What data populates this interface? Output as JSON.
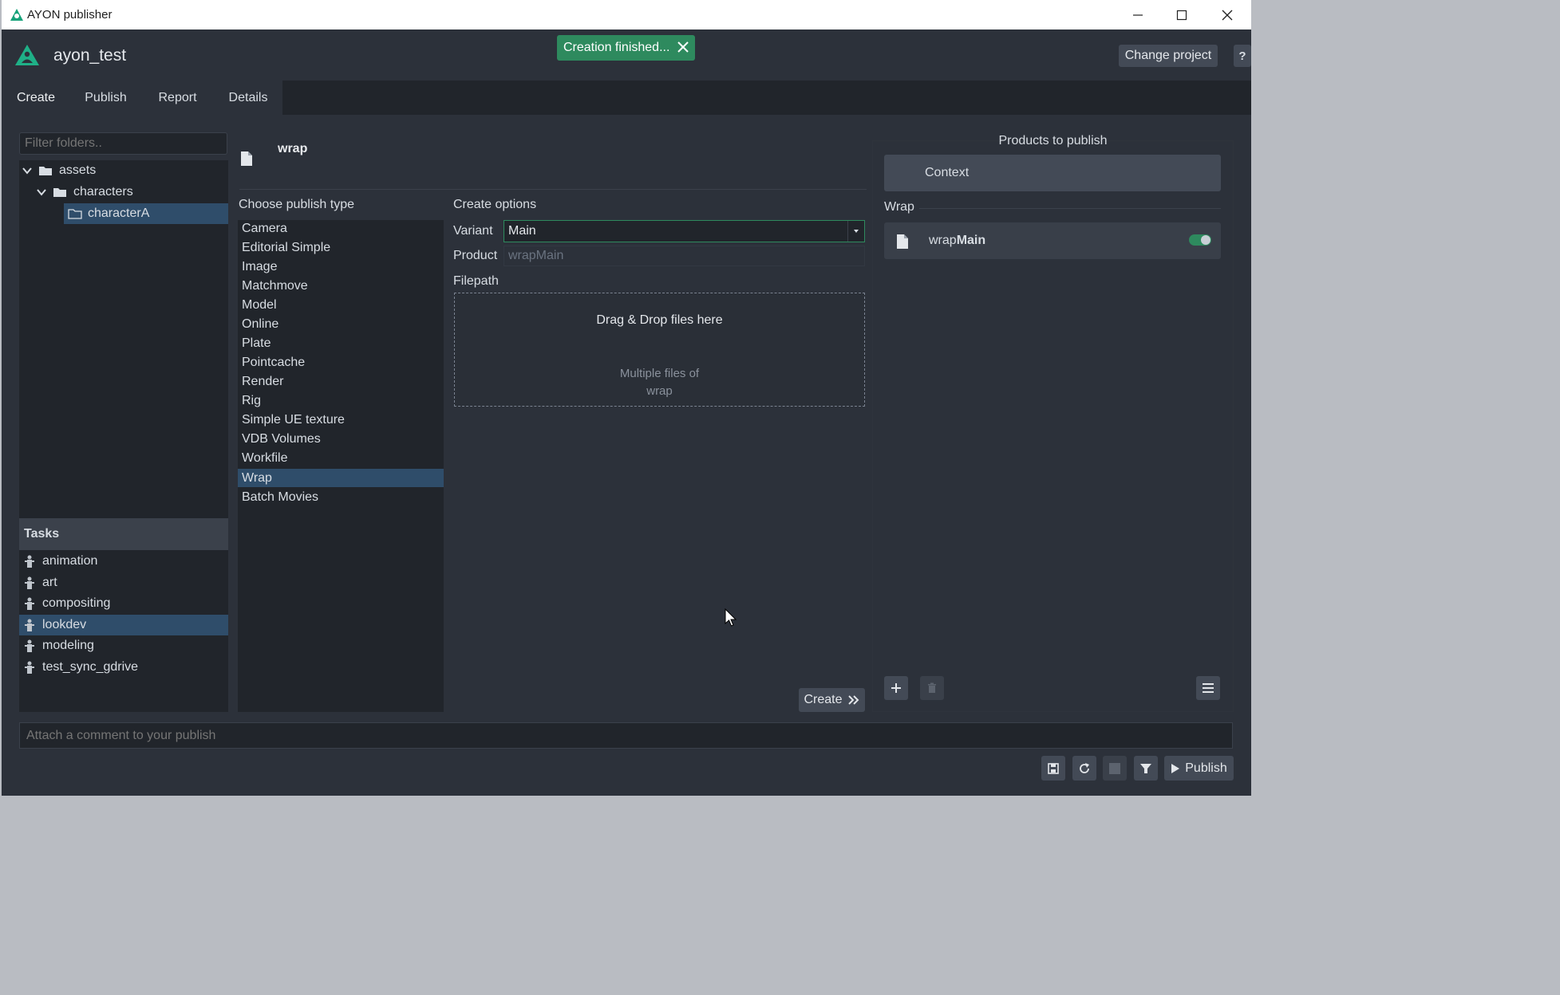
{
  "window": {
    "title": "AYON publisher"
  },
  "header": {
    "project": "ayon_test",
    "toast": "Creation finished...",
    "change_project": "Change project",
    "help": "?"
  },
  "tabs": [
    "Create",
    "Publish",
    "Report",
    "Details"
  ],
  "folders": {
    "filter_placeholder": "Filter folders..",
    "items": [
      "assets",
      "characters",
      "characterA"
    ]
  },
  "tasks": {
    "header": "Tasks",
    "items": [
      "animation",
      "art",
      "compositing",
      "lookdev",
      "modeling",
      "test_sync_gdrive"
    ],
    "selected": "lookdev"
  },
  "creator": {
    "title": "wrap",
    "choose_label": "Choose publish type",
    "types": [
      "Camera",
      "Editorial Simple",
      "Image",
      "Matchmove",
      "Model",
      "Online",
      "Plate",
      "Pointcache",
      "Render",
      "Rig",
      "Simple UE texture",
      "VDB Volumes",
      "Workfile",
      "Wrap",
      "Batch Movies"
    ],
    "selected_type": "Wrap",
    "options_label": "Create options",
    "variant_label": "Variant",
    "variant_value": "Main",
    "product_label": "Product",
    "product_value": "wrapMain",
    "filepath_label": "Filepath",
    "drop_text": "Drag & Drop files here",
    "drop_hint_1": "Multiple files of",
    "drop_hint_2": "wrap",
    "create_button": "Create"
  },
  "products": {
    "title": "Products to publish",
    "context": "Context",
    "group": "Wrap",
    "instance_prefix": "wrap",
    "instance_variant": "Main",
    "instance_enabled": true
  },
  "footer": {
    "comment_placeholder": "Attach a comment to your publish",
    "publish_button": "Publish"
  },
  "colors": {
    "accent": "#2e8a5e",
    "selection": "#2f4d6a",
    "background": "#2c313a",
    "panel": "#21252b"
  }
}
